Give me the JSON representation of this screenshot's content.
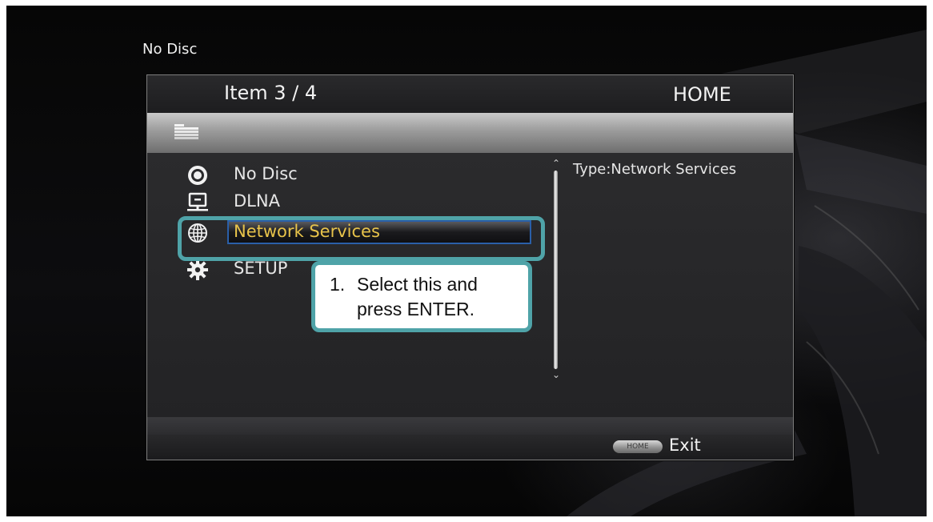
{
  "status": {
    "disc_text": "No Disc"
  },
  "header": {
    "item_counter": "Item 3 / 4",
    "title": "HOME"
  },
  "menu": {
    "items": [
      {
        "label": "No Disc",
        "icon": "disc-icon"
      },
      {
        "label": "DLNA",
        "icon": "dlna-network-icon"
      },
      {
        "label": "Network Services",
        "icon": "globe-icon",
        "selected": true
      },
      {
        "label": "SETUP",
        "icon": "gear-icon"
      }
    ]
  },
  "info": {
    "type_text": "Type:Network Services"
  },
  "footer": {
    "home_key_label": "HOME",
    "exit_label": "Exit"
  },
  "callout": {
    "number": "1.",
    "line1": "Select this and",
    "line2": "press ENTER."
  },
  "colors": {
    "selection_text": "#e8c34a",
    "callout_border": "#4fa3a8",
    "selection_border": "#2a5fa8"
  }
}
